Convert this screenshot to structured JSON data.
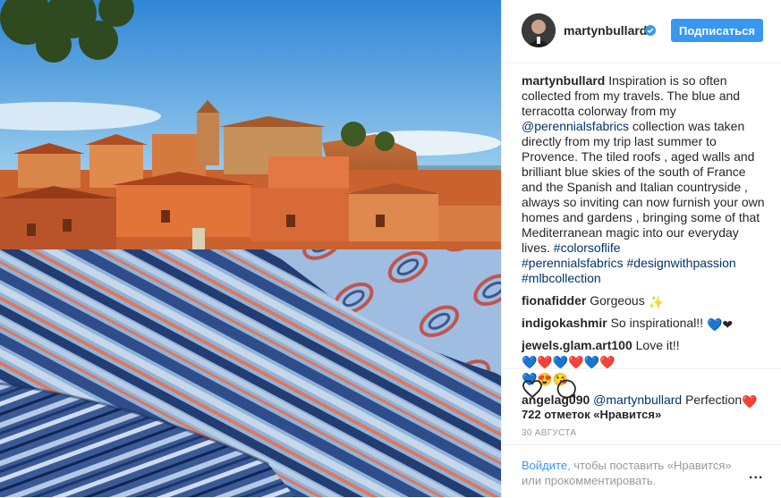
{
  "post": {
    "image_top_alt": "",
    "image_bottom_alt": ""
  },
  "header": {
    "username": "martynbullard",
    "follow_label": "Подписаться"
  },
  "caption": {
    "username": "martynbullard",
    "text_1": " Inspiration is so often collected from my travels. The blue and terracotta colorway from my ",
    "mention": "@perennialsfabrics",
    "text_2": " collection was taken directly from my trip last summer to Provence. The tiled roofs , aged walls and brilliant blue skies of the south of France and the Spanish and Italian countryside , always so inviting can now furnish your own homes and gardens , bringing some of that Mediterranean magic into our everyday lives. ",
    "tag_1": "#colorsoflife",
    "tag_2": "#perennialsfabrics",
    "tag_3": "#designwithpassion",
    "tag_4": "#mlbcollection"
  },
  "comments": [
    {
      "username": "fiona fidder",
      "handle": "fionafidder",
      "text": "Gorgeous ",
      "emoji": "✨"
    },
    {
      "username": "indigokashmir",
      "text": "So inspirational!! ",
      "emoji": "💙❤"
    },
    {
      "username": "jewels.glam.art100",
      "text": "Love it!!",
      "emoji": "💙❤️💙❤️💙❤️",
      "emoji_line2": "💙😍😘"
    },
    {
      "username": "angelag090",
      "mention": "@martynbullard",
      "text": " Perfection",
      "emoji": "❤️"
    }
  ],
  "actions": {
    "likes": "722 отметок «Нравится»",
    "date": "30 АВГУСТА"
  },
  "login": {
    "link": "Войдите",
    "text": ", чтобы поставить «Нравится» или прокомментировать.",
    "more": "..."
  },
  "colors": {
    "accent": "#3897f0",
    "link": "#003569",
    "muted": "#999999"
  }
}
